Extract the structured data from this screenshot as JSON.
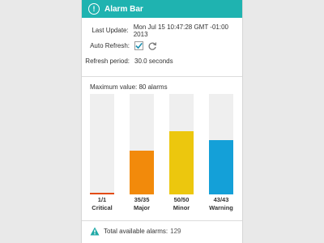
{
  "window": {
    "title": "Alarm Bar",
    "title_icon": "exclamation-circle-icon"
  },
  "info": {
    "last_update_label": "Last Update:",
    "last_update_value": "Mon Jul 15 10:47:28 GMT -01:00 2013",
    "auto_refresh_label": "Auto Refresh:",
    "auto_refresh_checked": true,
    "refresh_period_label": "Refresh period:",
    "refresh_period_value": "30.0 seconds"
  },
  "max_value_text": "Maximum value:  80 alarms",
  "chart_data": {
    "type": "bar",
    "max": 80,
    "categories": [
      "Critical",
      "Major",
      "Minor",
      "Warning"
    ],
    "values": [
      1,
      35,
      50,
      43
    ],
    "count_labels": [
      "1/1",
      "35/35",
      "50/50",
      "43/43"
    ],
    "colors": [
      "#e34b0f",
      "#f28a0b",
      "#ecc70e",
      "#14a0d8"
    ],
    "track_color": "#efefef"
  },
  "footer": {
    "label": "Total available alarms:",
    "count": "129",
    "icon": "warning-triangle-icon",
    "icon_color": "#1fa9a6"
  },
  "colors": {
    "accent": "#1fb3b0",
    "check": "#1b8fb0"
  }
}
